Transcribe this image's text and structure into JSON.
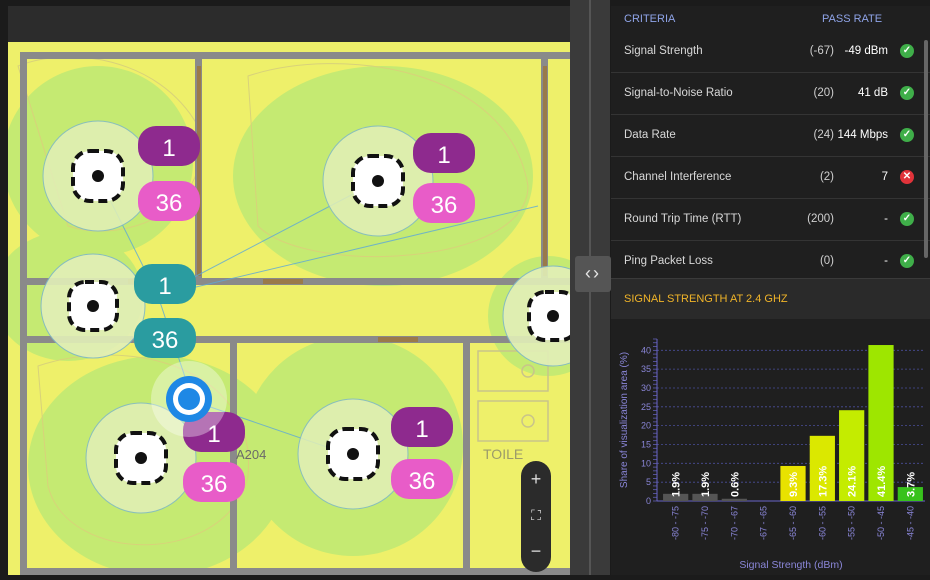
{
  "criteria_table": {
    "header_criteria": "CRITERIA",
    "header_pass_rate": "PASS RATE",
    "rows": [
      {
        "name": "Signal Strength",
        "threshold": "(-67)",
        "value": "-49 dBm",
        "status": "pass"
      },
      {
        "name": "Signal-to-Noise Ratio",
        "threshold": "(20)",
        "value": "41 dB",
        "status": "pass"
      },
      {
        "name": "Data Rate",
        "threshold": "(24)",
        "value": "144 Mbps",
        "status": "pass"
      },
      {
        "name": "Channel Interference",
        "threshold": "(2)",
        "value": "7",
        "status": "fail"
      },
      {
        "name": "Round Trip Time (RTT)",
        "threshold": "(200)",
        "value": "-",
        "status": "pass"
      },
      {
        "name": "Ping Packet Loss",
        "threshold": "(0)",
        "value": "-",
        "status": "pass"
      }
    ]
  },
  "signal_section": {
    "title": "SIGNAL STRENGTH AT 2.4 GHZ"
  },
  "map": {
    "room_label": "A204",
    "room_label_2": "TOILE",
    "access_points": [
      {
        "channel": "1",
        "number": "36",
        "color": "purple"
      },
      {
        "channel": "1",
        "number": "36",
        "color": "purple"
      },
      {
        "channel": "1",
        "number": "36",
        "color": "teal"
      },
      {
        "channel": "1",
        "number": "36",
        "color": "purple"
      },
      {
        "channel": "1",
        "number": "36",
        "color": "purple"
      }
    ],
    "zoom_in": "+",
    "zoom_fit": "⛶",
    "zoom_out": "−",
    "colors": {
      "heat_green": "#c5ea72",
      "heat_yellow": "#eef06a",
      "walls": "#8a8a8a",
      "ap_purple": "#8e2a8e",
      "ap_pink": "#e85cc8",
      "ap_teal": "#2a9ca0"
    }
  },
  "chart_data": {
    "type": "bar",
    "categories": [
      "-80 - -75",
      "-75 - -70",
      "-70 - -67",
      "-67 - -65",
      "-65 - -60",
      "-60 - -55",
      "-55 - -50",
      "-50 - -45",
      "-45 - -40"
    ],
    "values": [
      1.9,
      1.9,
      0.6,
      0,
      9.3,
      17.3,
      24.1,
      41.4,
      3.7
    ],
    "labels": [
      "1.9%",
      "1.9%",
      "0.6%",
      "",
      "9.3%",
      "17.3%",
      "24.1%",
      "41.4%",
      "3.7%"
    ],
    "bar_colors": [
      "#555555",
      "#555555",
      "#555555",
      "#555555",
      "#e8e200",
      "#dbe800",
      "#c4ec00",
      "#9ee600",
      "#38c21c"
    ],
    "xlabel": "Signal Strength (dBm)",
    "ylabel": "Share of visualization area (%)",
    "yticks": [
      0,
      5,
      10,
      15,
      20,
      25,
      30,
      35,
      40
    ],
    "ylim": [
      0,
      43
    ]
  }
}
